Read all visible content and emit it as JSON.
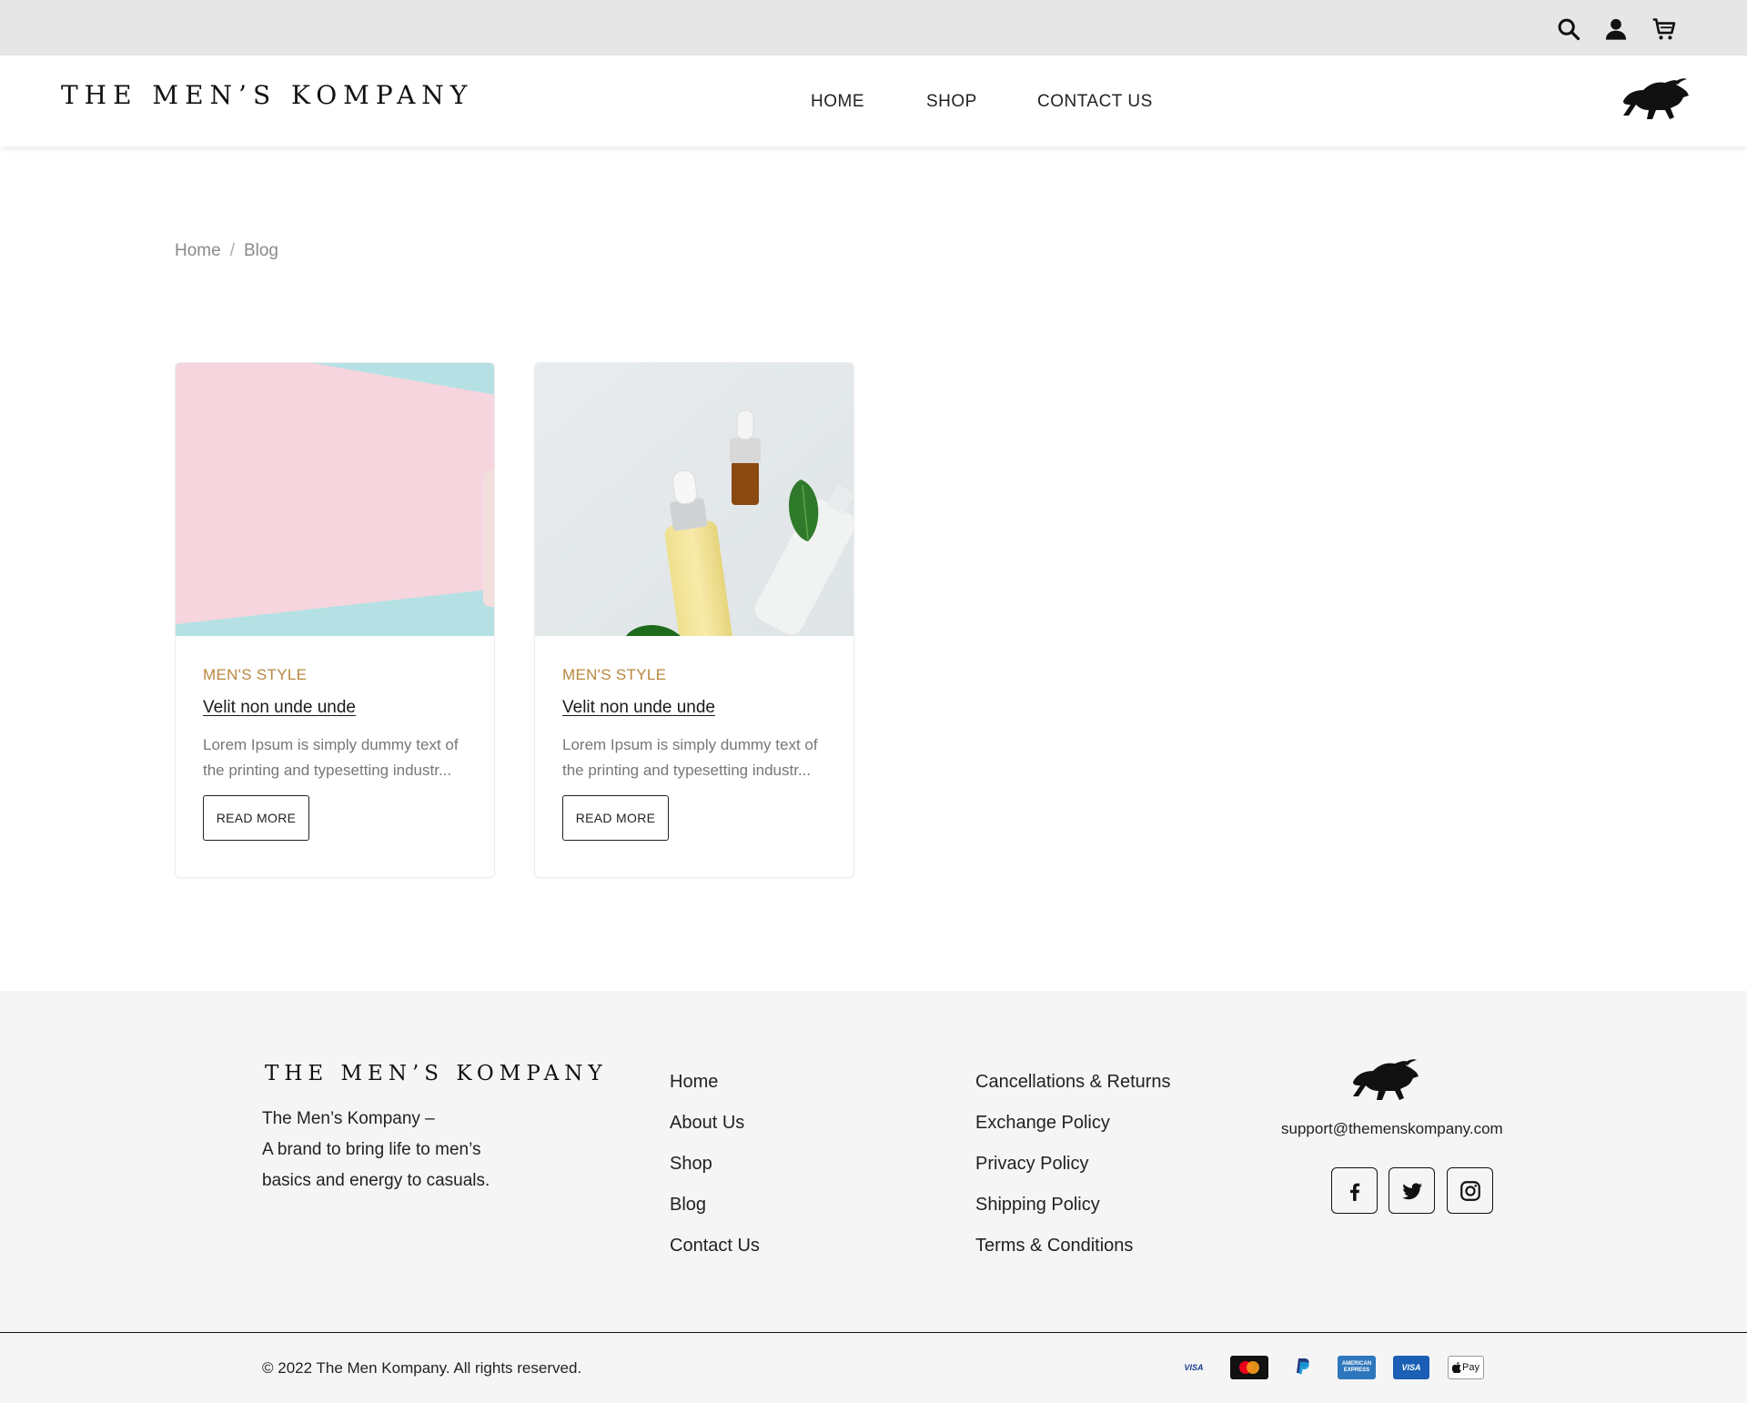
{
  "header": {
    "brand": "THE MEN’S KOMPANY",
    "nav": [
      "HOME",
      "SHOP",
      "CONTACT US"
    ],
    "icons": [
      "search-icon",
      "user-icon",
      "cart-icon",
      "bull-logo-icon"
    ]
  },
  "breadcrumb": {
    "home": "Home",
    "separator": "/",
    "current": "Blog"
  },
  "posts": [
    {
      "category": "MEN'S STYLE",
      "title": "Velit non unde unde",
      "excerpt": "Lorem Ipsum is simply dummy text of the printing and typesetting industr...",
      "button": "READ MORE",
      "image": "pink-and-teal-product-photo"
    },
    {
      "category": "MEN'S STYLE",
      "title": "Velit non unde unde",
      "excerpt": "Lorem Ipsum is simply dummy text of the printing and typesetting industr...",
      "button": "READ MORE",
      "image": "serum-bottles-and-leaves-photo"
    }
  ],
  "footer": {
    "brand": "THE MEN’S KOMPANY",
    "tagline_1": "The Men’s Kompany –",
    "tagline_2": "A brand to bring life to men’s",
    "tagline_3": "basics and energy to casuals.",
    "links_1": [
      "Home",
      "About Us",
      "Shop",
      "Blog",
      "Contact Us"
    ],
    "links_2": [
      "Cancellations & Returns",
      "Exchange Policy",
      "Privacy Policy",
      "Shipping Policy",
      "Terms & Conditions"
    ],
    "email": "support@themenskompany.com",
    "social": [
      "facebook-icon",
      "twitter-icon",
      "instagram-icon"
    ],
    "copyright": "© 2022 The Men Kompany. All rights reserved.",
    "payments": [
      "VISA",
      "mastercard",
      "PayPal",
      "AMERICAN EXPRESS",
      "VISA",
      "Pay"
    ]
  },
  "colors": {
    "topbar": "#e6e6e6",
    "accent_category": "#b8873e",
    "footer_bg": "#f5f5f5"
  }
}
